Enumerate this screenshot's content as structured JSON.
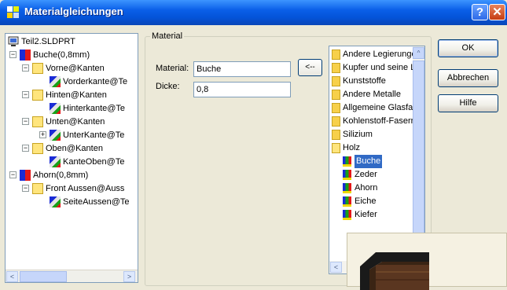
{
  "window": {
    "title": "Materialgleichungen",
    "help_btn": "?",
    "close_btn": "✕"
  },
  "tree": {
    "root": "Teil2.SLDPRT",
    "nodes": [
      {
        "label": "Buche(0,8mm)",
        "kind": "part",
        "expander": "−"
      },
      {
        "label": "Vorne@Kanten",
        "kind": "folder",
        "expander": "−"
      },
      {
        "label": "Vorderkante@Te",
        "kind": "edge",
        "expander": ""
      },
      {
        "label": "Hinten@Kanten",
        "kind": "folder",
        "expander": "−"
      },
      {
        "label": "Hinterkante@Te",
        "kind": "edge",
        "expander": ""
      },
      {
        "label": "Unten@Kanten",
        "kind": "folder",
        "expander": "−"
      },
      {
        "label": "UnterKante@Te",
        "kind": "edge",
        "expander": "+"
      },
      {
        "label": "Oben@Kanten",
        "kind": "folder",
        "expander": "−"
      },
      {
        "label": "KanteOben@Te",
        "kind": "edge",
        "expander": ""
      },
      {
        "label": "Ahorn(0,8mm)",
        "kind": "part",
        "expander": "−"
      },
      {
        "label": "Front Aussen@Auss",
        "kind": "folder",
        "expander": "−"
      },
      {
        "label": "SeiteAussen@Te",
        "kind": "edge",
        "expander": ""
      }
    ],
    "scroll_left": "<",
    "scroll_right": ">"
  },
  "material_group": {
    "legend": "Material",
    "material_label": "Material:",
    "material_value": "Buche",
    "dicke_label": "Dicke:",
    "dicke_value": "0,8",
    "assign_button": "<--"
  },
  "material_list": {
    "items": [
      {
        "label": "Andere Legierunge",
        "kind": "folder"
      },
      {
        "label": "Kupfer und seine L",
        "kind": "folder"
      },
      {
        "label": "Kunststoffe",
        "kind": "folder"
      },
      {
        "label": "Andere Metalle",
        "kind": "folder"
      },
      {
        "label": "Allgemeine Glasfas",
        "kind": "folder"
      },
      {
        "label": "Kohlenstoff-Faserr",
        "kind": "folder"
      },
      {
        "label": "Silizium",
        "kind": "folder"
      },
      {
        "label": "Holz",
        "kind": "folder-open"
      },
      {
        "label": "Buche",
        "kind": "material",
        "selected": true
      },
      {
        "label": "Zeder",
        "kind": "material"
      },
      {
        "label": "Ahorn",
        "kind": "material"
      },
      {
        "label": "Eiche",
        "kind": "material"
      },
      {
        "label": "Kiefer",
        "kind": "material"
      }
    ],
    "scroll_up": "^",
    "scroll_left": "<"
  },
  "buttons": {
    "ok": "OK",
    "cancel": "Abbrechen",
    "help": "Hilfe"
  },
  "colors": {
    "title_bar": "#0453d8",
    "selection": "#316ac5",
    "dialog_bg": "#ece9d8"
  }
}
